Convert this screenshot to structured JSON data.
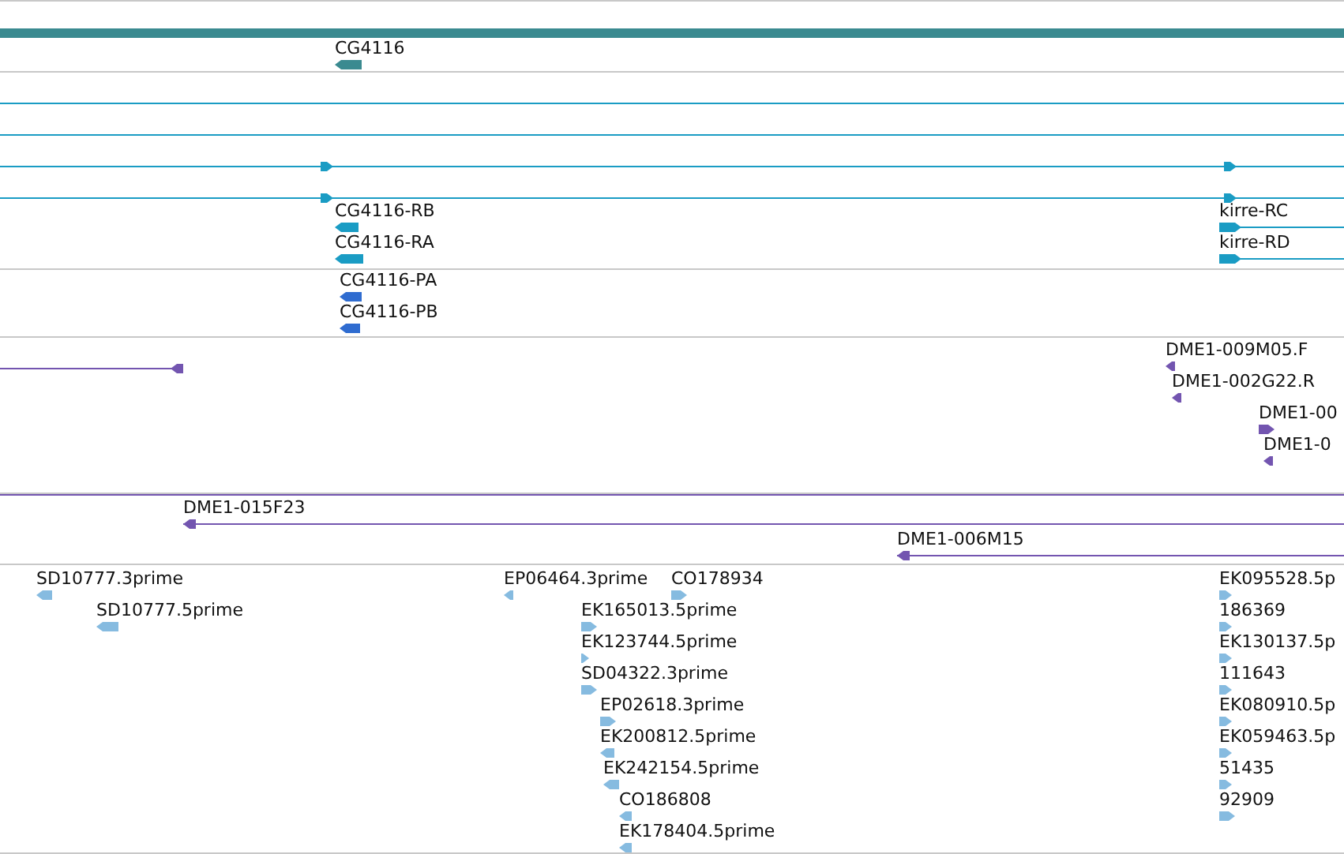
{
  "tracks": [
    {
      "color": "#3a8a90",
      "features": [
        {
          "kind": "bar"
        },
        {
          "kind": "glyph",
          "label": "CG4116",
          "reverse": true
        }
      ]
    },
    {
      "color": "#1a9cc4",
      "features": [
        {
          "kind": "line"
        },
        {
          "kind": "line"
        },
        {
          "kind": "line",
          "reverse": false
        },
        {
          "kind": "line",
          "reverse": false
        },
        {
          "kind": "glyph",
          "label": "CG4116-RB",
          "reverse": true
        },
        {
          "kind": "glyph",
          "label": "CG4116-RA",
          "reverse": true
        },
        {
          "kind": "glyph",
          "label": "kirre-RC",
          "reverse": false
        },
        {
          "kind": "glyph",
          "label": "kirre-RD",
          "reverse": false
        }
      ]
    },
    {
      "color": "#2f6cd0",
      "features": [
        {
          "kind": "glyph",
          "label": "CG4116-PA",
          "reverse": true
        },
        {
          "kind": "glyph",
          "label": "CG4116-PB",
          "reverse": true
        }
      ]
    },
    {
      "color": "#7355b0",
      "features": [
        {
          "kind": "line",
          "reverse": true
        },
        {
          "kind": "glyph",
          "label": "DME1-009M05.F",
          "reverse": true
        },
        {
          "kind": "glyph",
          "label": "DME1-002G22.R",
          "reverse": true
        },
        {
          "kind": "glyph",
          "label": "DME1-00",
          "reverse": false
        },
        {
          "kind": "glyph",
          "label": "DME1-0",
          "reverse": true
        },
        {
          "kind": "line"
        }
      ]
    },
    {
      "color": "#7355b0",
      "features": [
        {
          "kind": "glyph",
          "label": "DME1-015F23",
          "reverse": true
        },
        {
          "kind": "glyph",
          "label": "DME1-006M15",
          "reverse": true
        }
      ]
    },
    {
      "color": "#86bbe0",
      "features": [
        {
          "kind": "glyph",
          "label": "SD10777.3prime",
          "reverse": true
        },
        {
          "kind": "glyph",
          "label": "SD10777.5prime",
          "reverse": true
        },
        {
          "kind": "glyph",
          "label": "EP06464.3prime",
          "reverse": true
        },
        {
          "kind": "glyph",
          "label": "CO178934",
          "reverse": false
        },
        {
          "kind": "glyph",
          "label": "EK165013.5prime",
          "reverse": false
        },
        {
          "kind": "glyph",
          "label": "EK123744.5prime",
          "reverse": false
        },
        {
          "kind": "glyph",
          "label": "SD04322.3prime",
          "reverse": false
        },
        {
          "kind": "glyph",
          "label": "EP02618.3prime",
          "reverse": false
        },
        {
          "kind": "glyph",
          "label": "EK200812.5prime",
          "reverse": true
        },
        {
          "kind": "glyph",
          "label": "EK242154.5prime",
          "reverse": true
        },
        {
          "kind": "glyph",
          "label": "CO186808",
          "reverse": true
        },
        {
          "kind": "glyph",
          "label": "EK178404.5prime",
          "reverse": true
        },
        {
          "kind": "glyph",
          "label": "EK095528.5p",
          "reverse": false
        },
        {
          "kind": "glyph",
          "label": "186369",
          "reverse": false
        },
        {
          "kind": "glyph",
          "label": "EK130137.5p",
          "reverse": false
        },
        {
          "kind": "glyph",
          "label": "111643",
          "reverse": false
        },
        {
          "kind": "glyph",
          "label": "EK080910.5p",
          "reverse": false
        },
        {
          "kind": "glyph",
          "label": "EK059463.5p",
          "reverse": false
        },
        {
          "kind": "glyph",
          "label": "51435",
          "reverse": false
        },
        {
          "kind": "glyph",
          "label": "92909",
          "reverse": false
        }
      ]
    }
  ]
}
